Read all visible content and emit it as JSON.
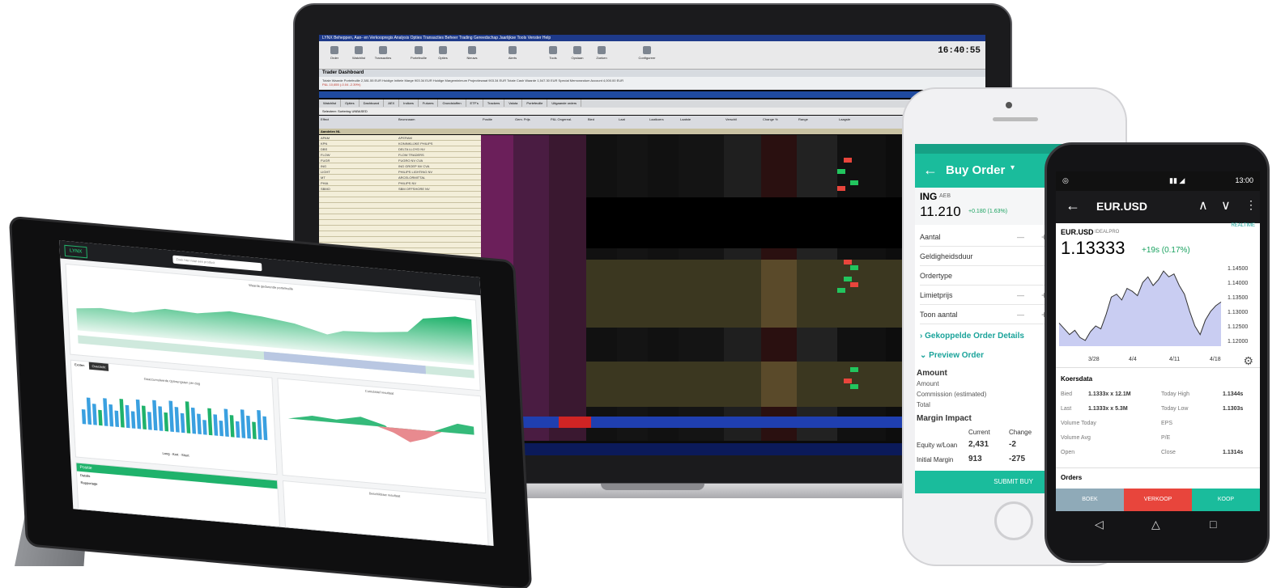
{
  "laptop": {
    "menu_title": "LYNX   Beheppen, Aan- en Verkoopregis   Analysis   Opties   Transacties   Beheer   Trading Gereedschap   Jaarlijkse Tools   Venster   Help",
    "clock": "16:40:55",
    "toolbar": [
      "Order",
      "Watchlist",
      "Transacties",
      "Portefeuille",
      "Opties",
      "Nieuws",
      "Alerts",
      "Tools",
      "Opslaan",
      "Zoeken",
      "Configureer"
    ],
    "dashboard_title": "Trader Dashboard",
    "dashboard_line": "Totale Waarde Portefeuille  2,381.55 EUR   Huidige Initiele Marge  903.34 EUR   Huidige Margeminimum Projectiewaat  903.34 EUR   Totale Cash Waarde  1,547.30 EUR   Special Memorandum Account  4,000.00 EUR",
    "pnl_line": "P&L  10,655 (-0.04 -2.39%)",
    "watch_title": "Watchlist",
    "tabs": [
      "Watchlist",
      "Opties",
      "Dashboard",
      "AEX",
      "Indices",
      "Futures",
      "Grondstoffen",
      "ETF's",
      "Trackers",
      "Valuta",
      "Portefeuille",
      "Uitgaande orders"
    ],
    "selector": "Selecteer: Sortering  UNBASED",
    "header": [
      "Effect",
      "Beursnaam",
      "Positie",
      "Gem. Prijs",
      "P&L Ongereal.",
      "Bied",
      "Laat",
      "Laatkoers",
      "Laatste",
      "Verschil",
      "Change %",
      "Range",
      "Laagste"
    ],
    "section": "Aandelen NL",
    "symbols": [
      "APAM",
      "KPN",
      "DBS",
      "FLOW",
      "FUGR",
      "ING",
      "LIGHT",
      "MT",
      "PHIA",
      "SBMO"
    ],
    "names": [
      "APERAM",
      "KONINKLIJKE PHILIPS",
      "DELTA LLOYD NV",
      "FLOW TRADERS",
      "FUGRO NV CVA",
      "ING GROEP NV CVA",
      "PHILIPS LIGHTING NV",
      "ARCELORMITTAL",
      "PHILIPS NV",
      "SBM OFFSHORE NV"
    ]
  },
  "tablet": {
    "logo": "LYNX",
    "search_placeholder": "Zoek hier naar een product",
    "main_chart_title": "Waarde gedurende portefeuille",
    "tabs": [
      "Exoten",
      "Overzicht"
    ],
    "bar_chart_title": "Geaccumuleerde Opbrengsten per dag",
    "cash_chart_title": "Cumulatief resultaat",
    "bottom_title": "Beschikbaar resultaat",
    "green_bar_label": "Positie",
    "legend": [
      "Long",
      "Kort",
      "Short"
    ],
    "rows": [
      "Details",
      "Rapportage"
    ]
  },
  "iphone": {
    "title": "Buy Order",
    "symbol": "ING",
    "exchange": "AEB",
    "price": "11.210",
    "change": "+0.180 (1.63%)",
    "fields": [
      "Aantal",
      "Geldigheidsduur",
      "Ordertype",
      "Limietprijs",
      "Toon aantal"
    ],
    "link1": "Gekoppelde Order Details",
    "link2": "Preview Order",
    "amount_header": "Amount",
    "amount_rows": [
      "Amount",
      "Commission (estimated)",
      "Total"
    ],
    "margin_header": "Margin Impact",
    "col_current": "Current",
    "col_change": "Change",
    "margin_rows": [
      {
        "label": "Equity w/Loan",
        "current": "2,431",
        "change": "-2"
      },
      {
        "label": "Initial Margin",
        "current": "913",
        "change": "-275"
      }
    ],
    "submit": "SUBMIT BUY"
  },
  "android": {
    "time": "13:00",
    "title": "EUR.USD",
    "pair": "EUR.USD",
    "source": "IDEALPRO",
    "realtime": "REALTIME",
    "price": "1.13333",
    "change": "+19s (0.17%)",
    "y_ticks": [
      "1.14500",
      "1.14000",
      "1.13500",
      "1.13000",
      "1.12500",
      "1.12000"
    ],
    "x_ticks": [
      "3/28",
      "4/4",
      "4/11",
      "4/18"
    ],
    "kd_title": "Koersdata",
    "kd": [
      {
        "l": "Bied",
        "v": "1.1333x x 12.1M",
        "l2": "Today High",
        "v2": "1.1344s"
      },
      {
        "l": "Last",
        "v": "1.1333x x 5.3M",
        "l2": "Today Low",
        "v2": "1.1303s"
      },
      {
        "l": "Volume Today",
        "v": "",
        "l2": "EPS",
        "v2": ""
      },
      {
        "l": "Volume Avg",
        "v": "",
        "l2": "P/E",
        "v2": ""
      },
      {
        "l": "Open",
        "v": "",
        "l2": "Close",
        "v2": "1.1314s"
      }
    ],
    "orders_title": "Orders",
    "buttons": [
      "BOEK",
      "VERKOOP",
      "KOOP"
    ]
  },
  "colors": {
    "accent": "#1abc9c",
    "lynx_green": "#22b36a",
    "sell": "#e8453c"
  }
}
